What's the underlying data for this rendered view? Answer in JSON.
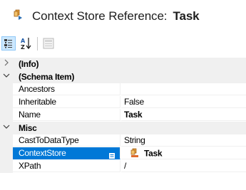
{
  "header": {
    "title_prefix": "Context Store Reference:",
    "title_name": "Task"
  },
  "toolbar": {
    "buttons": [
      {
        "icon": "categorized-icon",
        "active": true
      },
      {
        "icon": "alphabetical-sort-icon",
        "active": false
      },
      {
        "icon": "property-pages-icon",
        "active": false,
        "disabled": true
      }
    ]
  },
  "grid": {
    "categories": [
      {
        "label": "(Info)",
        "expanded": false,
        "properties": []
      },
      {
        "label": "(Schema Item)",
        "expanded": true,
        "properties": [
          {
            "name": "Ancestors",
            "value": ""
          },
          {
            "name": "Inheritable",
            "value": "False"
          },
          {
            "name": "Name",
            "value": "Task"
          }
        ]
      },
      {
        "label": "Misc",
        "expanded": true,
        "properties": [
          {
            "name": "CastToDataType",
            "value": "String"
          },
          {
            "name": "ContextStore",
            "value": "Task"
          },
          {
            "name": "XPath",
            "value": "/"
          }
        ]
      }
    ]
  }
}
